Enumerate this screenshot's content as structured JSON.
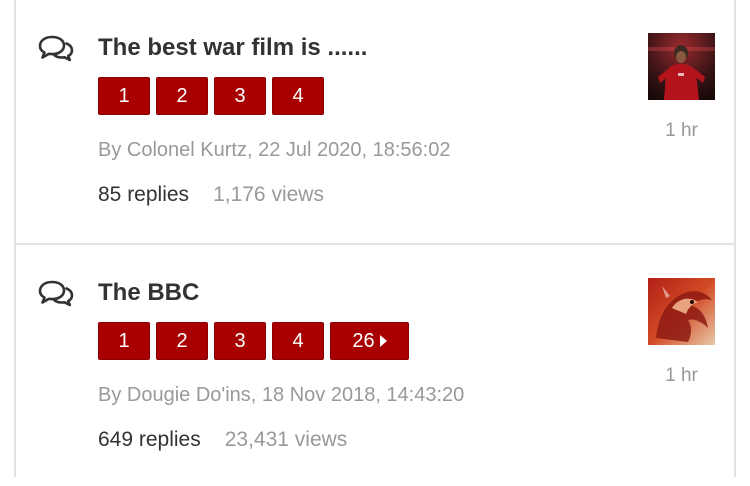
{
  "topics": [
    {
      "title": "The best war film is ......",
      "pages": [
        "1",
        "2",
        "3",
        "4"
      ],
      "byline": "By Colonel Kurtz, 22 Jul 2020, 18:56:02",
      "replies": "85 replies",
      "views": "1,176 views",
      "time": "1 hr"
    },
    {
      "title": "The BBC",
      "pages": [
        "1",
        "2",
        "3",
        "4"
      ],
      "last_page": "26",
      "byline": "By Dougie Do'ins, 18 Nov 2018, 14:43:20",
      "replies": "649 replies",
      "views": "23,431 views",
      "time": "1 hr"
    }
  ],
  "icons": {
    "topic": "chat-bubbles-icon",
    "next": "triangle-right-icon"
  },
  "colors": {
    "page_button": "#a80000",
    "title_text": "#333333",
    "muted_text": "#999999",
    "divider": "#e3e3e3"
  }
}
